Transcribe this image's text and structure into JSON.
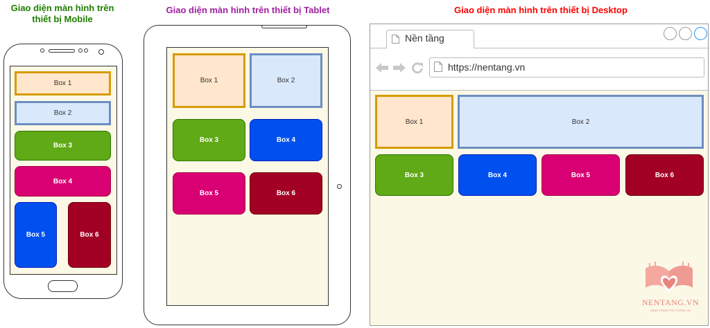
{
  "mobile": {
    "title_line1": "Giao diện màn hình trên",
    "title_line2": "thiết bị Mobile",
    "title_color": "#1e7e00",
    "boxes": [
      "Box 1",
      "Box 2",
      "Box 3",
      "Box 4",
      "Box 5",
      "Box 6"
    ]
  },
  "tablet": {
    "title": "Giao diện màn hình trên thiết bị Tablet",
    "title_color": "#a020a0",
    "boxes": [
      "Box 1",
      "Box 2",
      "Box 3",
      "Box 4",
      "Box 5",
      "Box 6"
    ]
  },
  "desktop": {
    "title": "Giao diện màn hình trên thiết bị Desktop",
    "title_color": "#ff0000",
    "tab_label": "Nền tầng",
    "url": "https://nentang.vn",
    "boxes": [
      "Box 1",
      "Box 2",
      "Box 3",
      "Box 4",
      "Box 5",
      "Box 6"
    ]
  },
  "watermark": {
    "brand": "NENTANG.VN",
    "tagline": "HÀNH TRANG TỚI TƯƠNG LAI",
    "color": "#e8847c"
  },
  "colors": {
    "peach_fill": "#ffe6cc",
    "peach_stroke": "#d79b00",
    "blue_fill": "#dae8fc",
    "blue_stroke": "#6c8ebf",
    "green": "#60a917",
    "cobalt": "#0050ef",
    "magenta": "#d80073",
    "crimson": "#a20025",
    "screen_bg": "#fbf8e6"
  }
}
